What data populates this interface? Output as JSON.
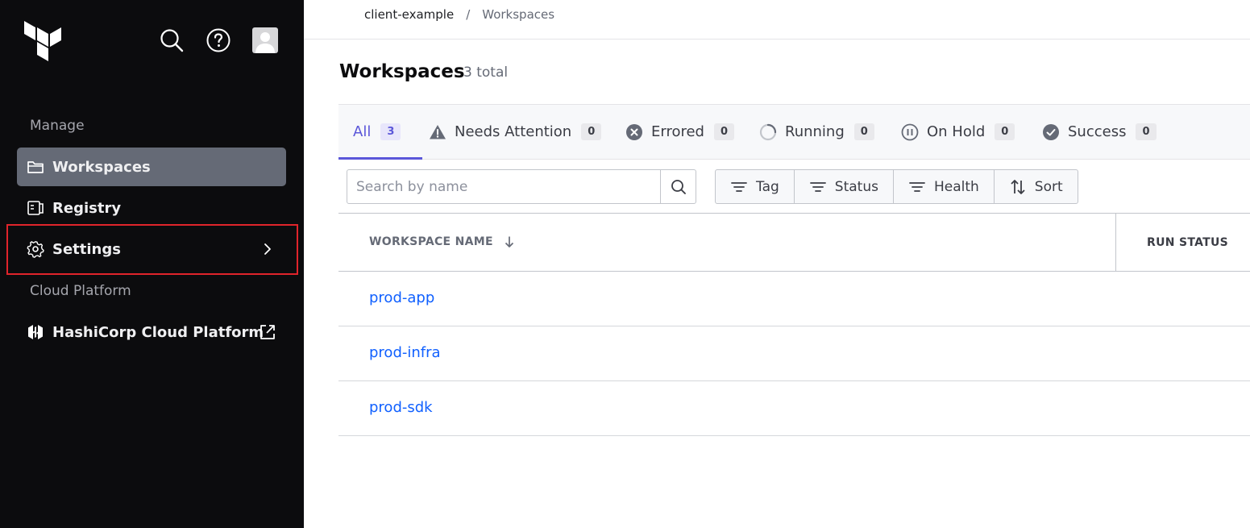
{
  "sidebar": {
    "icons": {
      "logo": "terraform-logo-icon",
      "search": "search-icon",
      "help": "help-icon",
      "avatar": "user-avatar-icon"
    },
    "sections": {
      "manage": "Manage",
      "cloud": "Cloud Platform"
    },
    "items": [
      {
        "label": "Workspaces",
        "icon": "folder-icon",
        "active": true
      },
      {
        "label": "Registry",
        "icon": "registry-icon",
        "active": false
      },
      {
        "label": "Settings",
        "icon": "gear-icon",
        "active": false
      },
      {
        "label": "HashiCorp Cloud Platform",
        "icon": "hashicorp-icon",
        "active": false
      }
    ]
  },
  "breadcrumb": {
    "org": "client-example",
    "separator": "/",
    "current": "Workspaces"
  },
  "page": {
    "title": "Workspaces",
    "count": "3 total"
  },
  "tabs": [
    {
      "label": "All",
      "count": "3",
      "icon": ""
    },
    {
      "label": "Needs Attention",
      "count": "0",
      "icon": "warning-icon"
    },
    {
      "label": "Errored",
      "count": "0",
      "icon": "error-icon"
    },
    {
      "label": "Running",
      "count": "0",
      "icon": "running-icon"
    },
    {
      "label": "On Hold",
      "count": "0",
      "icon": "pause-icon"
    },
    {
      "label": "Success",
      "count": "0",
      "icon": "check-circle-icon"
    }
  ],
  "search": {
    "placeholder": "Search by name",
    "value": ""
  },
  "filters": [
    {
      "label": "Tag",
      "icon": "filter-icon"
    },
    {
      "label": "Status",
      "icon": "filter-icon"
    },
    {
      "label": "Health",
      "icon": "filter-icon"
    },
    {
      "label": "Sort",
      "icon": "sort-icon"
    }
  ],
  "table": {
    "columns": [
      "WORKSPACE NAME",
      "RUN STATUS"
    ],
    "rows": [
      {
        "name": "prod-app"
      },
      {
        "name": "prod-infra"
      },
      {
        "name": "prod-sdk"
      }
    ]
  },
  "colors": {
    "sidebar_bg": "#0c0c0e",
    "active_nav": "#656a76",
    "accent": "#5b57d9",
    "link": "#1060ff",
    "highlight": "#e0242b"
  }
}
